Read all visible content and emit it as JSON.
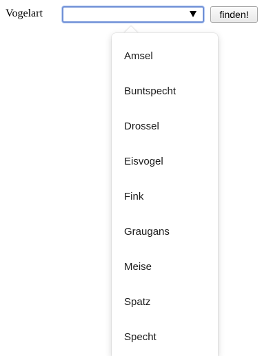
{
  "form": {
    "label": "Vogelart",
    "select_value": "",
    "submit_label": "finden!"
  },
  "dropdown": {
    "options": [
      "Amsel",
      "Buntspecht",
      "Drossel",
      "Eisvogel",
      "Fink",
      "Graugans",
      "Meise",
      "Spatz",
      "Specht"
    ]
  },
  "colors": {
    "focus_border": "#6e8fd6"
  }
}
